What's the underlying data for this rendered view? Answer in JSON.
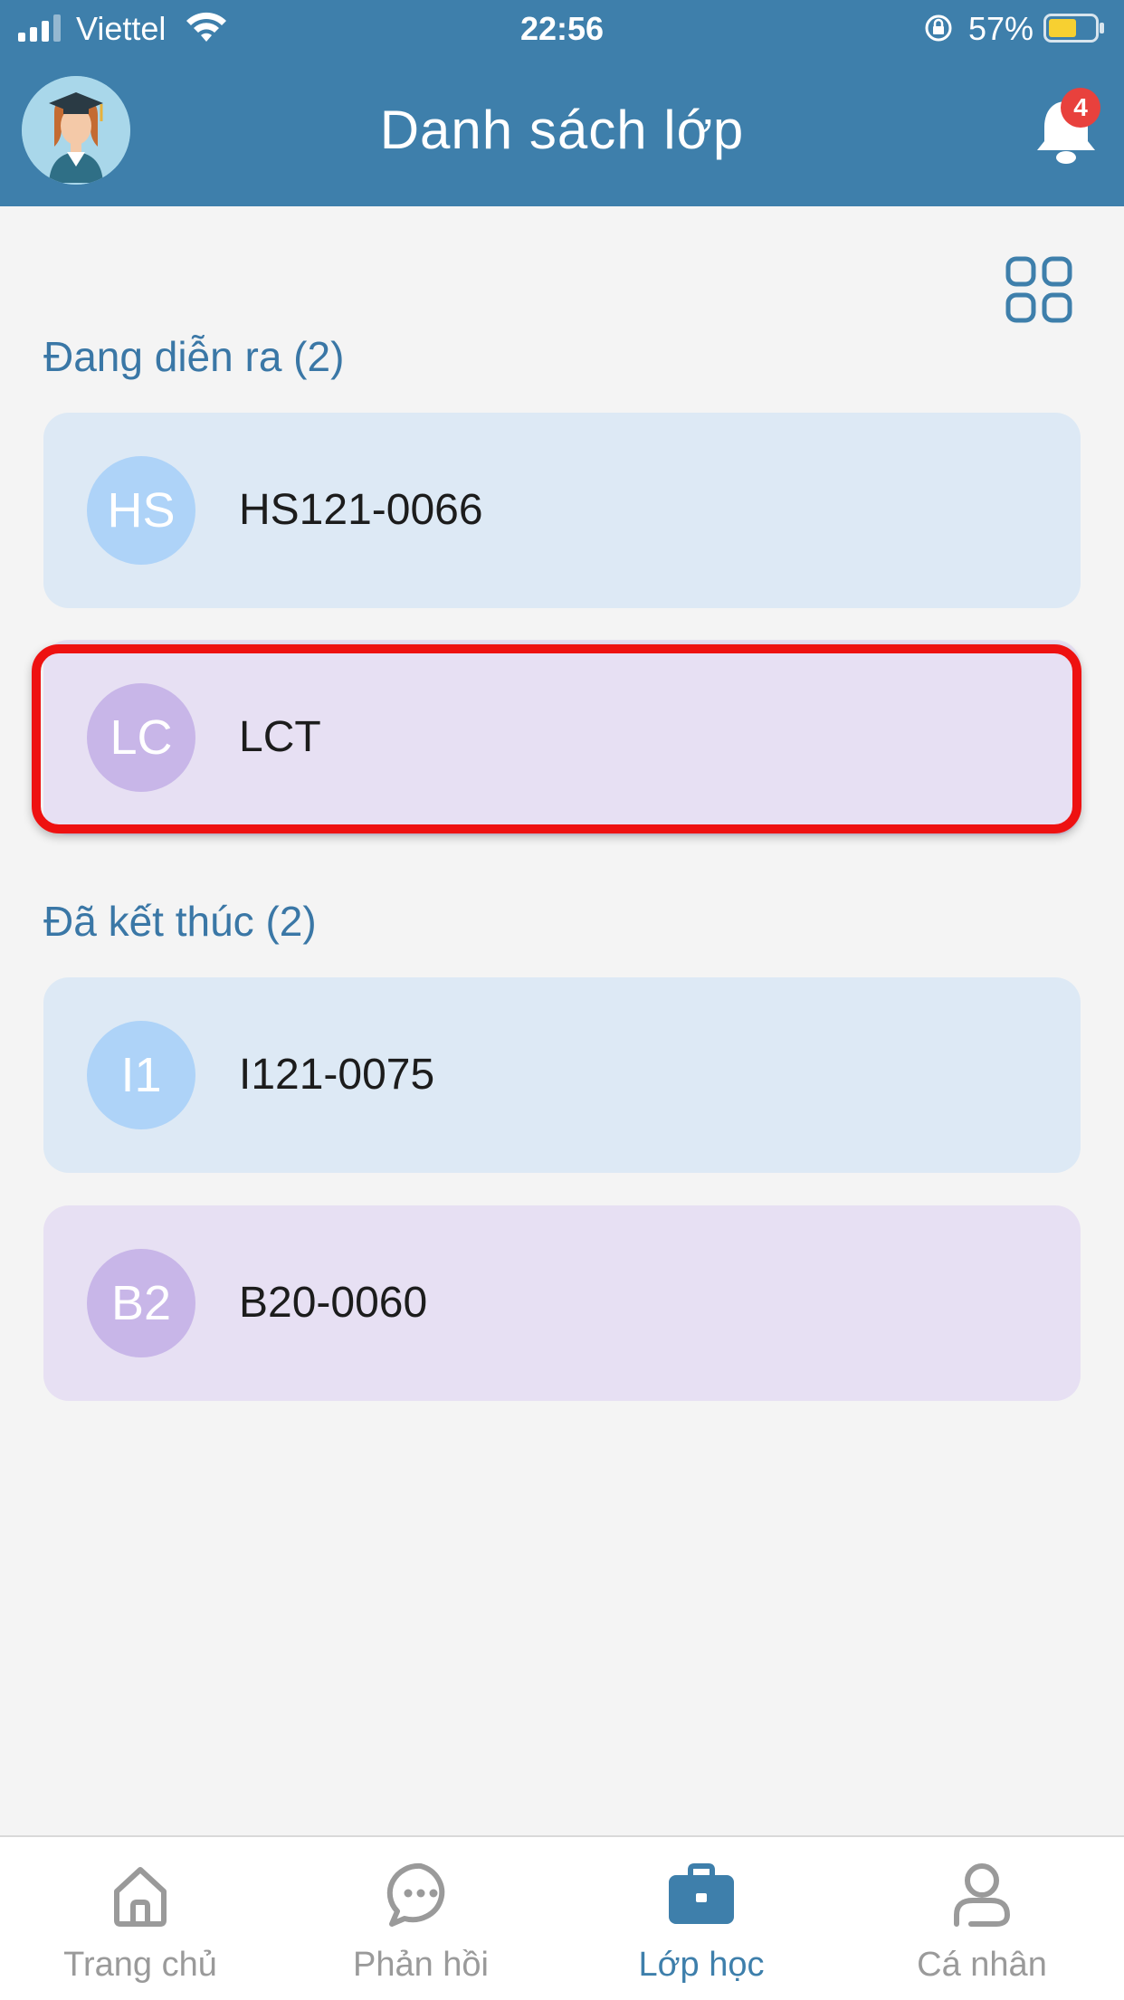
{
  "status_bar": {
    "carrier": "Viettel",
    "time": "22:56",
    "battery_percent": "57%"
  },
  "header": {
    "title": "Danh sách lớp",
    "notification_count": "4"
  },
  "sections": [
    {
      "title": "Đang diễn ra (2)",
      "classes": [
        {
          "initials": "HS",
          "name": "HS121-0066",
          "color": "blue"
        },
        {
          "initials": "LC",
          "name": "LCT",
          "color": "purple"
        }
      ]
    },
    {
      "title": "Đã kết thúc (2)",
      "classes": [
        {
          "initials": "I1",
          "name": "I121-0075",
          "color": "blue"
        },
        {
          "initials": "B2",
          "name": "B20-0060",
          "color": "purple"
        }
      ]
    }
  ],
  "tabs": [
    {
      "label": "Trang chủ",
      "icon": "home-icon",
      "active": false
    },
    {
      "label": "Phản hồi",
      "icon": "chat-icon",
      "active": false
    },
    {
      "label": "Lớp học",
      "icon": "briefcase-icon",
      "active": true
    },
    {
      "label": "Cá nhân",
      "icon": "person-icon",
      "active": false
    }
  ],
  "colors": {
    "header_bg": "#3e7fab",
    "accent": "#3a77a6",
    "card_blue": "#dde9f5",
    "card_purple": "#e7e0f3",
    "highlight": "#ee1111",
    "badge": "#e8413d"
  }
}
